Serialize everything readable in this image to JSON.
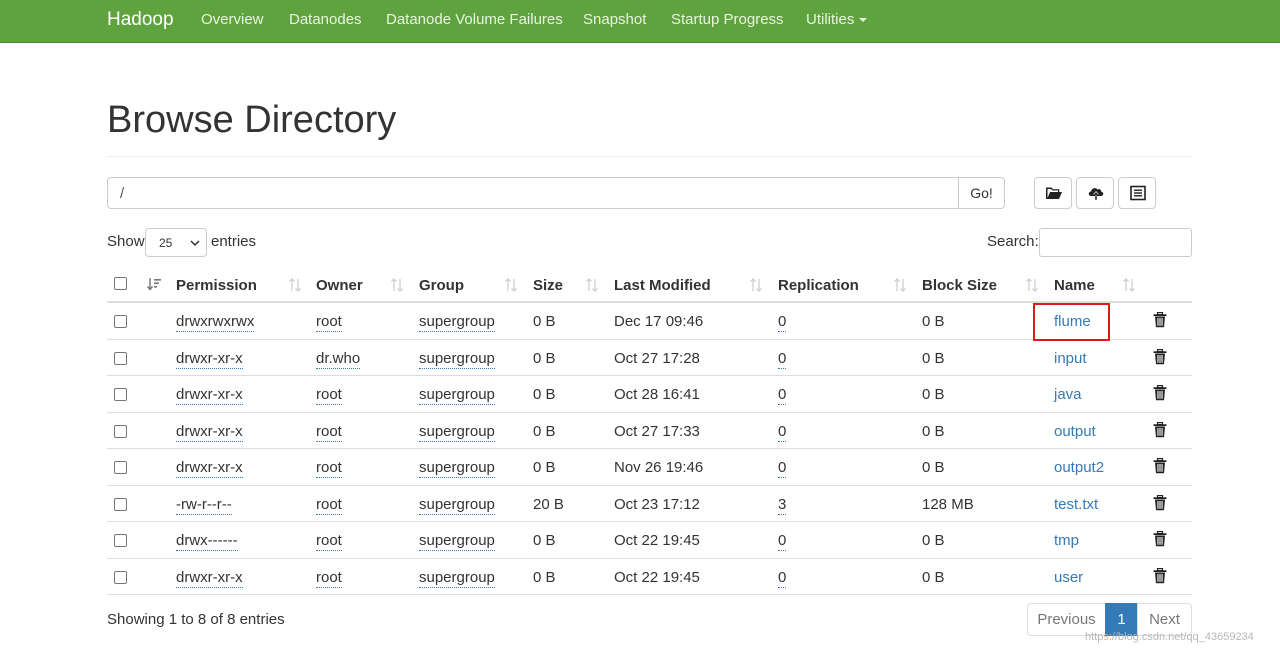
{
  "navbar": {
    "brand": "Hadoop",
    "items": [
      "Overview",
      "Datanodes",
      "Datanode Volume Failures",
      "Snapshot",
      "Startup Progress",
      "Utilities"
    ]
  },
  "page_title": "Browse Directory",
  "directory": {
    "value": "/",
    "go_label": "Go!"
  },
  "toolbar_icons": [
    "folder-open-icon",
    "upload-cloud-icon",
    "list-alt-icon"
  ],
  "length_menu": {
    "show_label": "Show",
    "selected": "25",
    "entries_label": "entries"
  },
  "search": {
    "label": "Search:"
  },
  "table": {
    "columns": [
      "Permission",
      "Owner",
      "Group",
      "Size",
      "Last Modified",
      "Replication",
      "Block Size",
      "Name"
    ],
    "rows": [
      {
        "permission": "drwxrwxrwx",
        "owner": "root",
        "group": "supergroup",
        "size": "0 B",
        "modified": "Dec 17 09:46",
        "replication": "0",
        "block_size": "0 B",
        "name": "flume"
      },
      {
        "permission": "drwxr-xr-x",
        "owner": "dr.who",
        "group": "supergroup",
        "size": "0 B",
        "modified": "Oct 27 17:28",
        "replication": "0",
        "block_size": "0 B",
        "name": "input"
      },
      {
        "permission": "drwxr-xr-x",
        "owner": "root",
        "group": "supergroup",
        "size": "0 B",
        "modified": "Oct 28 16:41",
        "replication": "0",
        "block_size": "0 B",
        "name": "java"
      },
      {
        "permission": "drwxr-xr-x",
        "owner": "root",
        "group": "supergroup",
        "size": "0 B",
        "modified": "Oct 27 17:33",
        "replication": "0",
        "block_size": "0 B",
        "name": "output"
      },
      {
        "permission": "drwxr-xr-x",
        "owner": "root",
        "group": "supergroup",
        "size": "0 B",
        "modified": "Nov 26 19:46",
        "replication": "0",
        "block_size": "0 B",
        "name": "output2"
      },
      {
        "permission": "-rw-r--r--",
        "owner": "root",
        "group": "supergroup",
        "size": "20 B",
        "modified": "Oct 23 17:12",
        "replication": "3",
        "block_size": "128 MB",
        "name": "test.txt"
      },
      {
        "permission": "drwx------",
        "owner": "root",
        "group": "supergroup",
        "size": "0 B",
        "modified": "Oct 22 19:45",
        "replication": "0",
        "block_size": "0 B",
        "name": "tmp"
      },
      {
        "permission": "drwxr-xr-x",
        "owner": "root",
        "group": "supergroup",
        "size": "0 B",
        "modified": "Oct 22 19:45",
        "replication": "0",
        "block_size": "0 B",
        "name": "user"
      }
    ]
  },
  "footer": {
    "info": "Showing 1 to 8 of 8 entries",
    "previous": "Previous",
    "current_page": "1",
    "next": "Next"
  },
  "watermark": "https://blog.csdn.net/qq_43659234",
  "colors": {
    "navbar": "#5fa33f",
    "link": "#337ab7",
    "highlight": "#e21818"
  }
}
